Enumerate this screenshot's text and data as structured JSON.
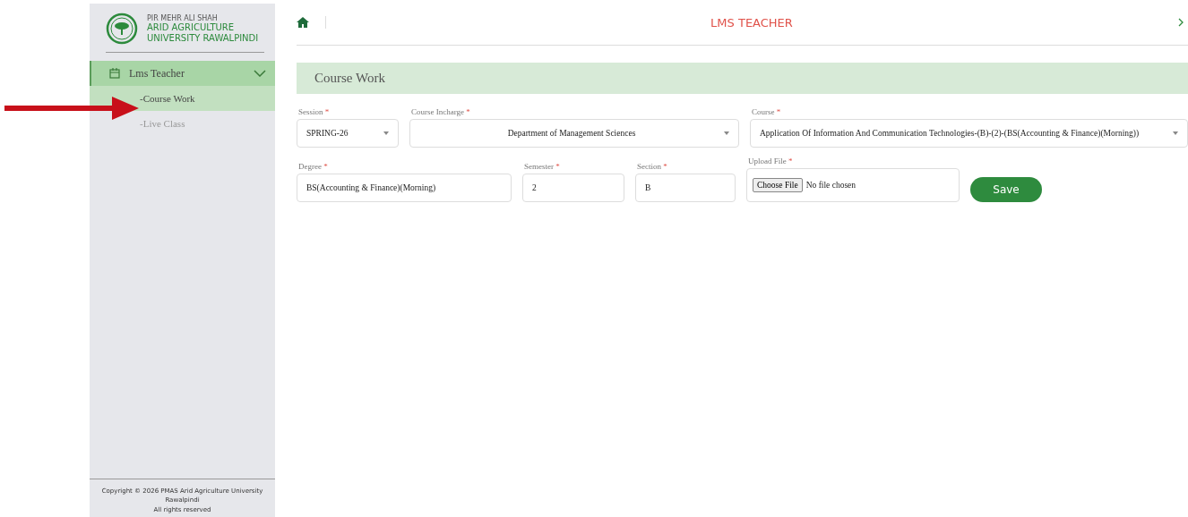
{
  "sidebar": {
    "logo": {
      "line1": "PIR MEHR ALI SHAH",
      "line2": "ARID AGRICULTURE",
      "line3": "UNIVERSITY RAWALPINDI"
    },
    "menu": [
      {
        "label": "Lms Teacher",
        "expanded": true,
        "children": [
          {
            "label": "-Course Work",
            "selected": true
          },
          {
            "label": "-Live Class",
            "selected": false
          }
        ]
      }
    ],
    "footer": {
      "copyright": "Copyright © 2026 PMAS Arid Agriculture University Rawalpindi",
      "rights": "All rights reserved"
    }
  },
  "header": {
    "title": "LMS TEACHER"
  },
  "section": {
    "title": "Course Work"
  },
  "form": {
    "top_fields": [
      {
        "kind": "select",
        "label": "Session",
        "mark": "*",
        "value": "SPRING-26"
      },
      {
        "kind": "select",
        "label": "Course Incharge",
        "mark": "*",
        "value": "Department of Management Sciences"
      },
      {
        "kind": "select",
        "label": "Course",
        "mark": "*",
        "value": "Application Of Information And Communication Technologies-(B)-(2)-(BS(Accounting & Finance)(Morning))"
      }
    ],
    "bottom_fields": [
      {
        "kind": "text",
        "label": "Degree",
        "mark": "*",
        "value": "BS(Accounting & Finance)(Morning)"
      },
      {
        "kind": "text",
        "label": "Semester",
        "mark": "*",
        "value": "2"
      },
      {
        "kind": "text",
        "label": "Section",
        "mark": "*",
        "value": "B"
      },
      {
        "kind": "file",
        "label": "Upload File",
        "mark": "*",
        "button": "Choose File",
        "value": "No file chosen"
      }
    ],
    "save": "Save"
  }
}
